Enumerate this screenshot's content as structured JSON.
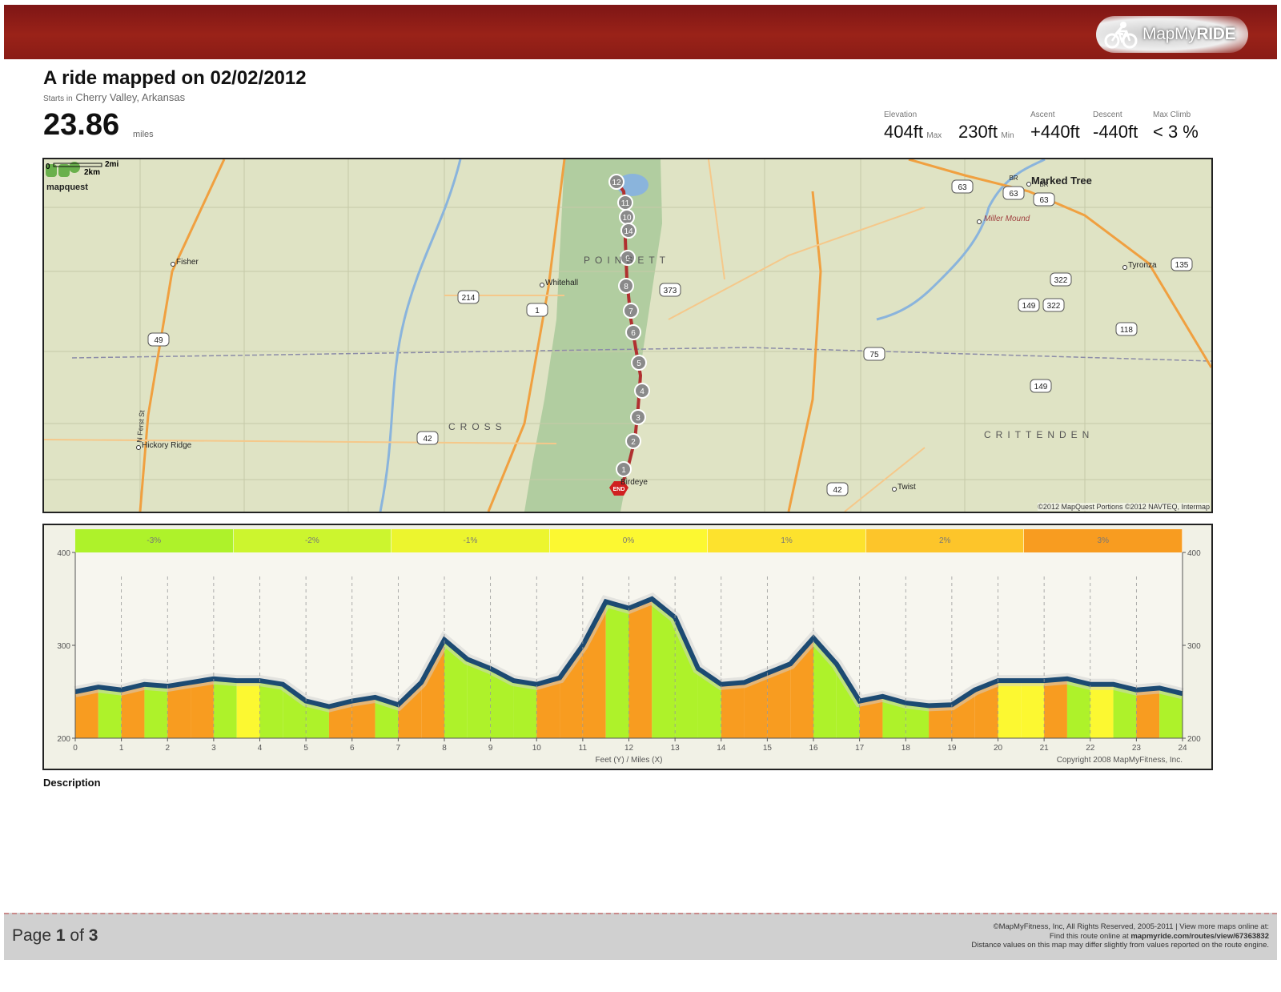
{
  "brand": {
    "name_regular": "MapMy",
    "name_bold": "RIDE",
    "icon": "cyclist-icon"
  },
  "title": "A ride mapped on 02/02/2012",
  "start": {
    "prefix": "Starts in",
    "location": "Cherry Valley, Arkansas"
  },
  "distance": {
    "value": "23.86",
    "unit": "miles"
  },
  "stats": {
    "elevation_label": "Elevation",
    "max_value": "404ft",
    "max_suffix": "Max",
    "min_value": "230ft",
    "min_suffix": "Min",
    "ascent_label": "Ascent",
    "ascent_value": "+440ft",
    "descent_label": "Descent",
    "descent_value": "-440ft",
    "maxclimb_label": "Max Climb",
    "maxclimb_value": "< 3 %"
  },
  "map": {
    "provider": "mapquest",
    "copyright": "©2012 MapQuest  Portions ©2012 NAVTEQ, Intermap",
    "scale_mi": "2mi",
    "scale_km": "2km",
    "scale_zero": "0",
    "region_labels": [
      "P O I N S E T T",
      "C R O S S",
      "C R I T T E N D E N"
    ],
    "towns": [
      "Fisher",
      "Whitehall",
      "Hickory Ridge",
      "Marked Tree",
      "Miller Mound",
      "Tyronza",
      "Twist",
      "Birdeye"
    ],
    "street": "N Ferst St",
    "shields": [
      "214",
      "1",
      "373",
      "49",
      "42",
      "63",
      "63",
      "63",
      "135",
      "322",
      "149",
      "322",
      "118",
      "75",
      "149",
      "42"
    ],
    "shield_prefixes": [
      "BR",
      "BR"
    ],
    "markers": [
      "12",
      "11",
      "10",
      "14",
      "9",
      "8",
      "7",
      "6",
      "5",
      "4",
      "3",
      "2",
      "1"
    ],
    "end_label": "END",
    "colors": {
      "route": "#b03030",
      "roads": "#f0a040",
      "water": "#8ab4dc",
      "forest": "#a9c99a"
    }
  },
  "chart_data": {
    "type": "area",
    "title": "",
    "xlabel": "Feet (Y) / Miles (X)",
    "ylabel": "",
    "xlim": [
      0,
      24
    ],
    "ylim": [
      200,
      400
    ],
    "x_ticks": [
      0,
      1,
      2,
      3,
      4,
      5,
      6,
      7,
      8,
      9,
      10,
      11,
      12,
      13,
      14,
      15,
      16,
      17,
      18,
      19,
      20,
      21,
      22,
      23,
      24
    ],
    "y_ticks": [
      200,
      300,
      400
    ],
    "x_tick_labels": [
      "0",
      "1",
      "2",
      "3",
      "4",
      "5",
      "6",
      "7",
      "8",
      "9",
      "10",
      "11",
      "12",
      "13",
      "14",
      "15",
      "16",
      "17",
      "18",
      "19",
      "20",
      "21",
      "22",
      "23",
      "24"
    ],
    "y_tick_labels": [
      "200",
      "300",
      "400"
    ],
    "grade_legend": [
      "-3%",
      "-2%",
      "-1%",
      "0%",
      "1%",
      "2%",
      "3%"
    ],
    "grade_colors": [
      "#aef22a",
      "#ccf52e",
      "#ecf52e",
      "#fcf831",
      "#fde22d",
      "#fdc52a",
      "#f89c20"
    ],
    "copyright": "Copyright 2008 MapMyFitness, Inc.",
    "series": [
      {
        "x": [
          0,
          0.5,
          1,
          1.5,
          2,
          2.5,
          3,
          3.5,
          4,
          4.5,
          5,
          5.5,
          6,
          6.5,
          7,
          7.5,
          8,
          8.5,
          9,
          9.5,
          10,
          10.5,
          11,
          11.5,
          12,
          12.5,
          13,
          13.5,
          14,
          14.5,
          15,
          15.5,
          16,
          16.5,
          17,
          17.5,
          18,
          18.5,
          19,
          19.5,
          20,
          20.5,
          21,
          21.5,
          22,
          22.5,
          23,
          23.5,
          24
        ],
        "y": [
          250,
          255,
          252,
          258,
          256,
          260,
          264,
          262,
          262,
          258,
          240,
          234,
          240,
          244,
          236,
          260,
          306,
          285,
          275,
          262,
          258,
          265,
          300,
          347,
          340,
          350,
          330,
          275,
          258,
          260,
          270,
          280,
          308,
          280,
          240,
          245,
          238,
          235,
          236,
          252,
          262,
          262,
          262,
          264,
          258,
          258,
          252,
          254,
          248
        ]
      }
    ]
  },
  "description_label": "Description",
  "footer": {
    "page_prefix": "Page",
    "page_current": "1",
    "page_of": "of",
    "page_total": "3",
    "line1": "©MapMyFitness, Inc, All Rights Reserved, 2005-2011    |    View more maps online at:",
    "line2_prefix": "Find this route online at",
    "line2_link": "mapmyride.com/routes/view/67363832",
    "line3": "Distance values on this map may differ slightly from values reported on the route engine."
  }
}
